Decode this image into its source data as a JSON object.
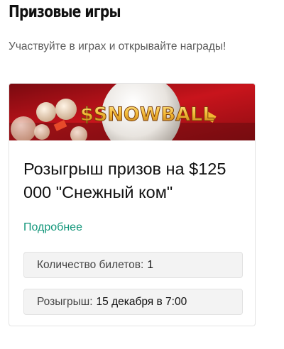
{
  "page": {
    "title": "Призовые игры",
    "subtitle": "Участвуйте в играх и открывайте награды!"
  },
  "card": {
    "banner_text": "$SNOWBALL",
    "title": "Розыгрыш призов на $125 000 \"Снежный ком\"",
    "more_link": "Подробнее",
    "tickets_label": "Количество билетов:",
    "tickets_value": "1",
    "draw_label": "Розыгрыш:",
    "draw_value": "15 декабря в 7:00"
  },
  "colors": {
    "link": "#12967a",
    "banner_red": "#c8141c",
    "banner_gold": "#f2b632"
  }
}
